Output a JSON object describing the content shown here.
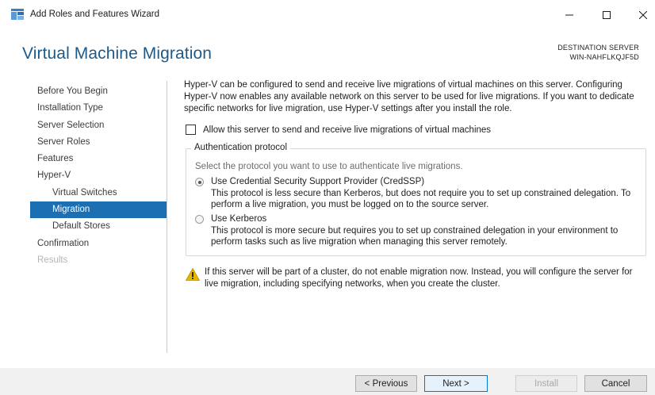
{
  "window": {
    "title": "Add Roles and Features Wizard",
    "minimize": "—",
    "maximize": "☐",
    "close": "✕"
  },
  "header": {
    "page_title": "Virtual Machine Migration",
    "destination_label": "DESTINATION SERVER",
    "destination_value": "WIN-NAHFLKQJF5D"
  },
  "nav": {
    "items": [
      {
        "label": "Before You Begin"
      },
      {
        "label": "Installation Type"
      },
      {
        "label": "Server Selection"
      },
      {
        "label": "Server Roles"
      },
      {
        "label": "Features"
      },
      {
        "label": "Hyper-V"
      },
      {
        "label": "Virtual Switches"
      },
      {
        "label": "Migration"
      },
      {
        "label": "Default Stores"
      },
      {
        "label": "Confirmation"
      },
      {
        "label": "Results"
      }
    ]
  },
  "content": {
    "intro": "Hyper-V can be configured to send and receive live migrations of virtual machines on this server. Configuring Hyper-V now enables any available network on this server to be used for live migrations. If you want to dedicate specific networks for live migration, use Hyper-V settings after you install the role.",
    "allow_checkbox_label": "Allow this server to send and receive live migrations of virtual machines",
    "auth_group": {
      "legend": "Authentication protocol",
      "description": "Select the protocol you want to use to authenticate live migrations.",
      "credssp_title": "Use Credential Security Support Provider (CredSSP)",
      "credssp_detail": "This protocol is less secure than Kerberos, but does not require you to set up constrained delegation. To perform a live migration, you must be logged on to the source server.",
      "kerberos_title": "Use Kerberos",
      "kerberos_detail": "This protocol is more secure but requires you to set up constrained delegation in your environment to perform tasks such as live migration when managing this server remotely."
    },
    "warning": "If this server will be part of a cluster, do not enable migration now. Instead, you will configure the server for live migration, including specifying networks, when you create the cluster."
  },
  "footer": {
    "previous": "< Previous",
    "next": "Next >",
    "install": "Install",
    "cancel": "Cancel"
  },
  "colors": {
    "accent": "#1c6fb3",
    "title": "#1c5a8a",
    "warning": "#e8b700"
  }
}
